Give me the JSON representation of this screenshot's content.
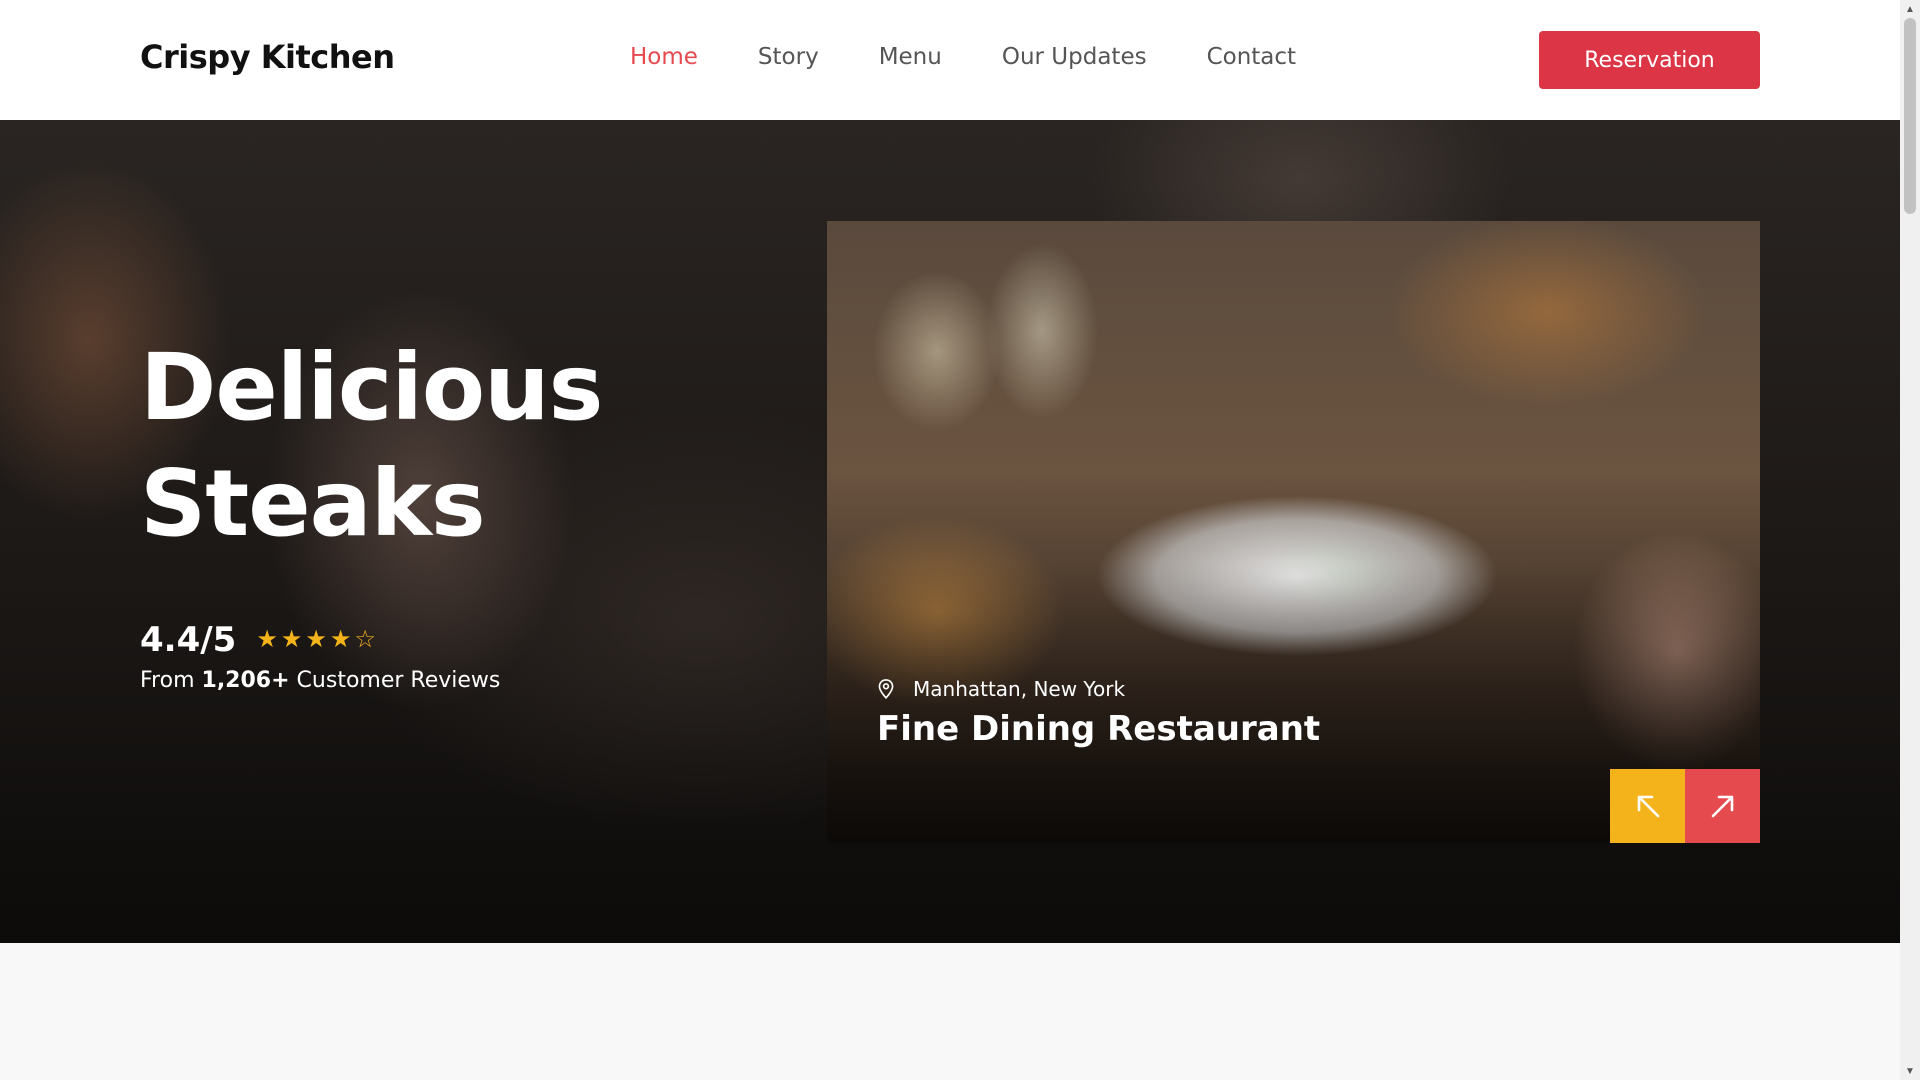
{
  "brand": {
    "name": "Crispy Kitchen"
  },
  "nav": {
    "items": [
      {
        "label": "Home",
        "active": true
      },
      {
        "label": "Story",
        "active": false
      },
      {
        "label": "Menu",
        "active": false
      },
      {
        "label": "Our Updates",
        "active": false
      },
      {
        "label": "Contact",
        "active": false
      }
    ],
    "cta_label": "Reservation"
  },
  "hero": {
    "title_line1": "Delicious",
    "title_line2": "Steaks",
    "rating": "4.4/5",
    "stars_filled": 4,
    "stars_total": 5,
    "reviews_prefix": "From",
    "reviews_count": "1,206+",
    "reviews_suffix": "Customer Reviews"
  },
  "feature_card": {
    "location": "Manhattan, New York",
    "title": "Fine Dining Restaurant",
    "prev_icon": "arrow-up-left-icon",
    "next_icon": "arrow-up-right-icon"
  },
  "colors": {
    "accent_red": "#dc3545",
    "nav_active": "#e54a4f",
    "star_yellow": "#f5b31b",
    "prev_button": "#f5b31b",
    "next_button": "#e54a4f"
  }
}
